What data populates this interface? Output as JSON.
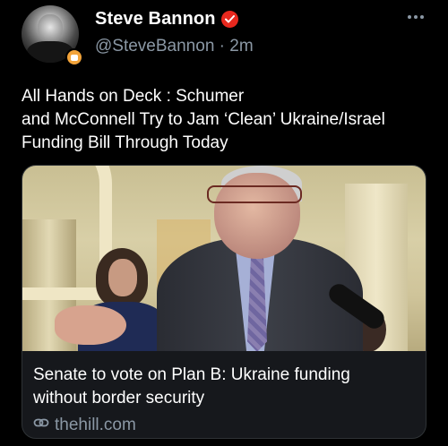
{
  "author": {
    "display_name": "Steve Bannon",
    "handle": "@SteveBannon",
    "separator": "·",
    "timestamp": "2m",
    "verified_badge": "red-verified-badge-icon",
    "affiliation_badge": "orange-affiliation-badge-icon"
  },
  "more_menu": "more-options-icon",
  "tweet": {
    "lines": [
      "All Hands on Deck : Schumer",
      "and McConnell Try to Jam ‘Clean’ Ukraine/Israel",
      "Funding Bill Through Today"
    ]
  },
  "link_card": {
    "title_lines": [
      "Senate to vote on Plan B: Ukraine funding",
      "without border security"
    ],
    "domain": "thehill.com",
    "domain_icon": "link-icon"
  },
  "colors": {
    "background": "#000000",
    "text_primary": "#ffffff",
    "text_secondary": "#8b98a5",
    "verified": "#e8281e",
    "affiliation": "#f2a33a",
    "card_background": "#16181c"
  }
}
